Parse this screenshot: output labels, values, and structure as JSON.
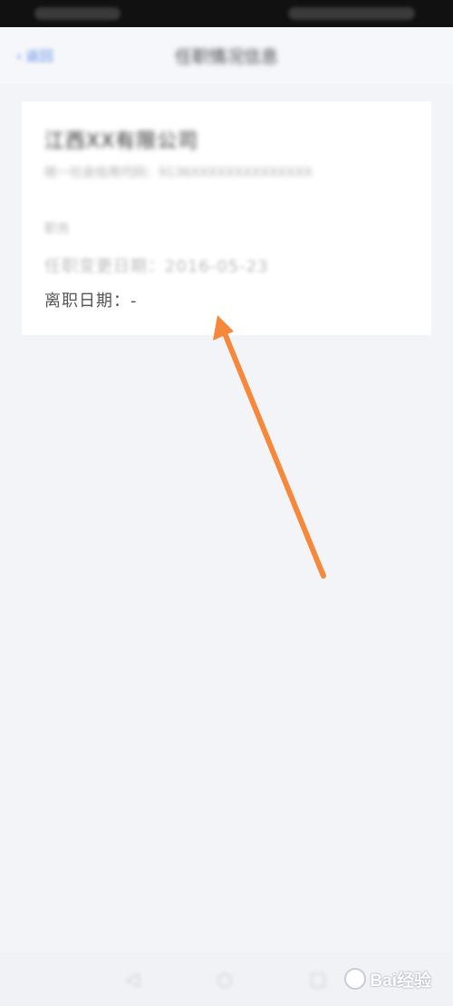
{
  "navbar": {
    "back_label": "‹ 返回",
    "title": "任职情况信息"
  },
  "card": {
    "company": "江西XX有限公司",
    "description": "统一社会信用代码：9136XXXXXXXXXXXXXX",
    "tag": "职务",
    "entry_date_label": "任职变更日期：",
    "entry_date_value": "2016-05-23",
    "leave_date_label": "离职日期：",
    "leave_date_value": "-"
  },
  "system_nav": {
    "back_icon": "triangle-back-icon",
    "home_icon": "circle-home-icon",
    "recents_icon": "square-recents-icon"
  },
  "watermark": {
    "text": "Bai经验"
  },
  "colors": {
    "background": "#f3f4f8",
    "card": "#ffffff",
    "accent": "#5b8de6",
    "arrow": "#f5883a"
  }
}
